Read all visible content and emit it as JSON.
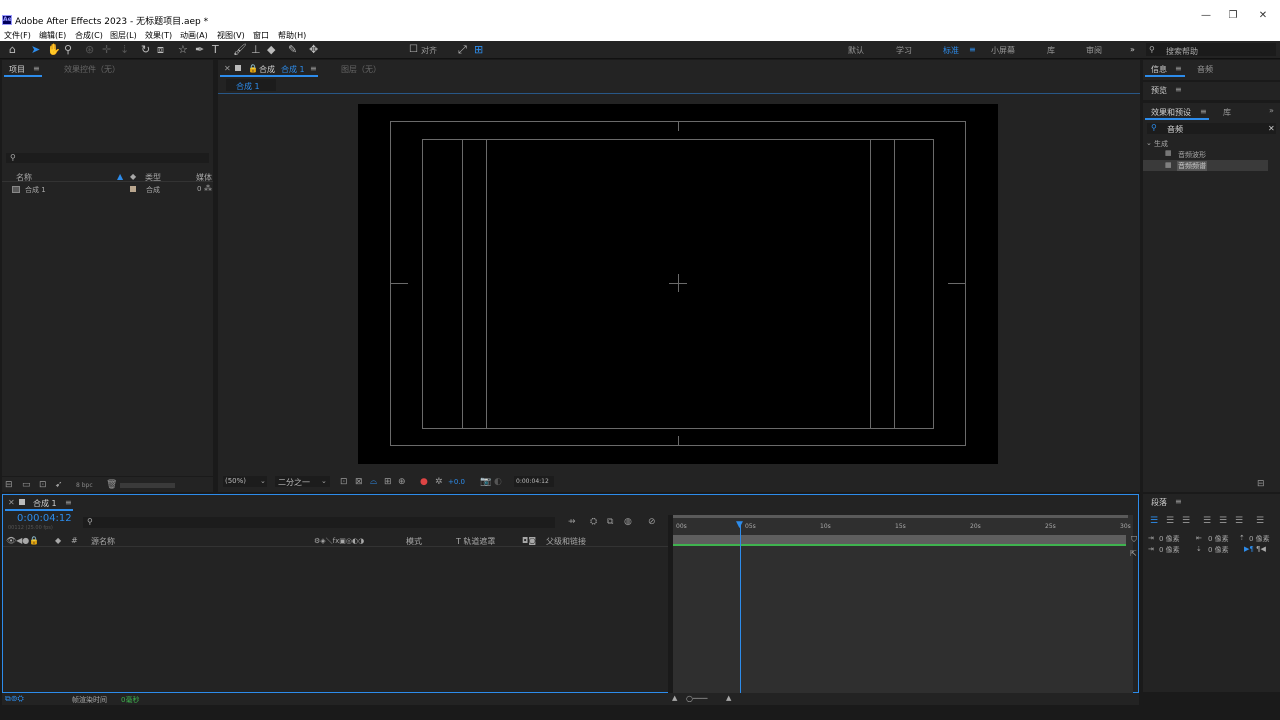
{
  "app": {
    "title": "Adobe After Effects 2023 - 无标题项目.aep *",
    "logo": "Ae"
  },
  "window_controls": {
    "minimize": "—",
    "restore": "❐",
    "close": "✕"
  },
  "menu": [
    "文件(F)",
    "编辑(E)",
    "合成(C)",
    "图层(L)",
    "效果(T)",
    "动画(A)",
    "视图(V)",
    "窗口",
    "帮助(H)"
  ],
  "toolbar": {
    "align_label": "对齐",
    "workspaces": [
      "默认",
      "学习",
      "标准",
      "小屏幕",
      "库",
      "审阅"
    ],
    "active_workspace": "标准",
    "search_help": "搜索帮助"
  },
  "project_panel": {
    "tab_project": "项目",
    "tab_effects_controls": "效果控件（无）",
    "col_name": "名称",
    "col_type": "类型",
    "col_media": "媒体",
    "items": [
      {
        "name": "合成 1",
        "type": "合成",
        "media": "0"
      }
    ],
    "bpc": "8 bpc"
  },
  "comp_panel": {
    "tab_comp": "合成",
    "tab_comp_name": "合成 1",
    "tab_layer": "图层（无）",
    "breadcrumb": "合成 1",
    "zoom": "(50%)",
    "resolution": "二分之一",
    "exposure": "+0.0",
    "timecode": "0:00:04:12"
  },
  "right_panels": {
    "info": "信息",
    "audio": "音频",
    "preview": "预览",
    "effects_presets": "效果和预设",
    "library": "库",
    "search_value": "音频",
    "group": "生成",
    "effects": [
      "音频波形",
      "音频频谱"
    ],
    "paragraph": "段落",
    "para_values": [
      "0 像素",
      "0 像素",
      "0 像素",
      "0 像素",
      "0 像素"
    ]
  },
  "timeline": {
    "tab": "合成 1",
    "timecode": "0:00:04:12",
    "timecode_sub": "00112 (25.00 fps)",
    "col_source": "源名称",
    "col_mode": "模式",
    "col_track": "T  轨道遮罩",
    "col_parent": "父级和链接",
    "ruler": [
      "00s",
      "05s",
      "10s",
      "15s",
      "20s",
      "25s",
      "30s"
    ],
    "render_label": "帧渲染时间",
    "render_value": "0毫秒"
  },
  "colors": {
    "accent": "#2d8ceb",
    "green": "#3fb34f",
    "panel": "#232323"
  }
}
